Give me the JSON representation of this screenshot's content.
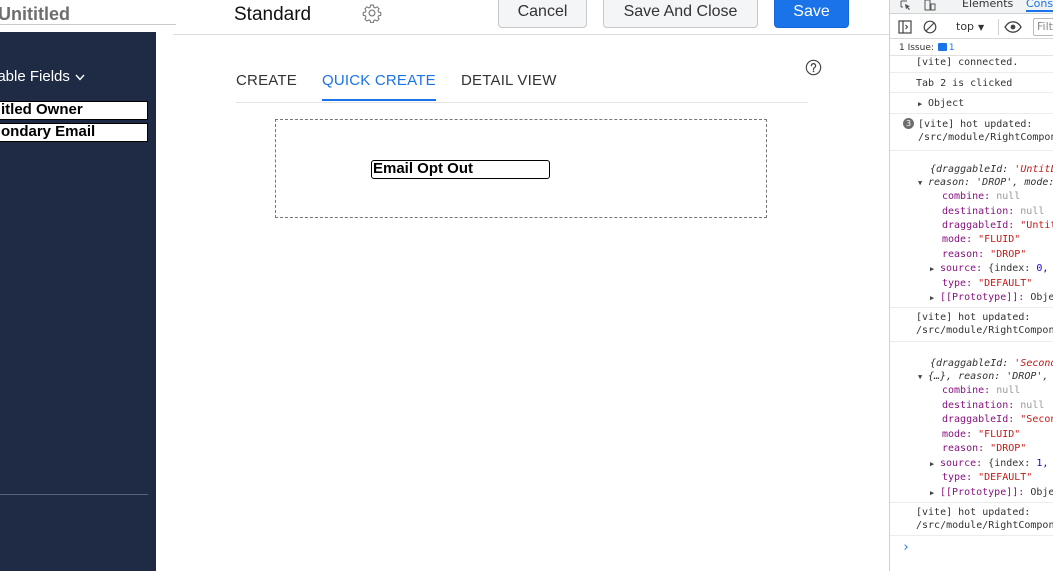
{
  "editor": {
    "title": "Unititled",
    "layout_name": "Standard",
    "buttons": {
      "cancel": "Cancel",
      "save_close": "Save And Close",
      "save": "Save"
    },
    "tabs": [
      "CREATE",
      "QUICK CREATE",
      "DETAIL VIEW"
    ],
    "active_tab": "QUICK CREATE",
    "dropped_field": "Email Opt Out",
    "colors": {
      "accent": "#1a73e8",
      "sidebar": "#1f2a44"
    }
  },
  "sidebar": {
    "header": "lable Fields",
    "fields": [
      "itled Owner",
      "ondary Email"
    ]
  },
  "devtools": {
    "tabs": {
      "elements": "Elements",
      "console": "Conso"
    },
    "context": "top",
    "filter_placeholder": "Filt",
    "issues": {
      "label": "1 Issue:",
      "count": "1"
    },
    "logs": {
      "l1": "[vite] connected.",
      "l2": "Tab 2 is clicked",
      "l3": "Object",
      "l4_badge": "3",
      "l4a": "[vite] hot updated:",
      "l4b": "/src/module/RightCompon",
      "obj1_line1_key": "{draggableId: ",
      "obj1_line1_val": "'UntitL",
      "obj1_line2": "reason: 'DROP', mode:",
      "obj1": {
        "combine": "combine: ",
        "combine_v": "null",
        "destination": "destination: ",
        "destination_v": "null",
        "draggableId": "draggableId: ",
        "draggableId_v": "\"Untit",
        "mode": "mode: ",
        "mode_v": "\"FLUID\"",
        "reason": "reason: ",
        "reason_v": "\"DROP\"",
        "source": "source: ",
        "source_v": "{index: ",
        "source_n": "0,",
        "type": "type: ",
        "type_v": "\"DEFAULT\"",
        "proto": "[[Prototype]]: ",
        "proto_v": "Obje"
      },
      "l5a": "[vite] hot updated:",
      "l5b": "/src/module/RightCompon",
      "obj2_line1_key": "{draggableId: ",
      "obj2_line1_val": "'Second",
      "obj2_line2": "{…}, reason: 'DROP',",
      "obj2": {
        "combine": "combine: ",
        "combine_v": "null",
        "destination": "destination: ",
        "destination_v": "null",
        "draggableId": "draggableId: ",
        "draggableId_v": "\"Secon",
        "mode": "mode: ",
        "mode_v": "\"FLUID\"",
        "reason": "reason: ",
        "reason_v": "\"DROP\"",
        "source": "source: ",
        "source_v": "{index: ",
        "source_n": "1,",
        "type": "type: ",
        "type_v": "\"DEFAULT\"",
        "proto": "[[Prototype]]: ",
        "proto_v": "Obje"
      },
      "l6a": "[vite] hot updated:",
      "l6b": "/src/module/RightCompon"
    },
    "prompt": "›"
  }
}
